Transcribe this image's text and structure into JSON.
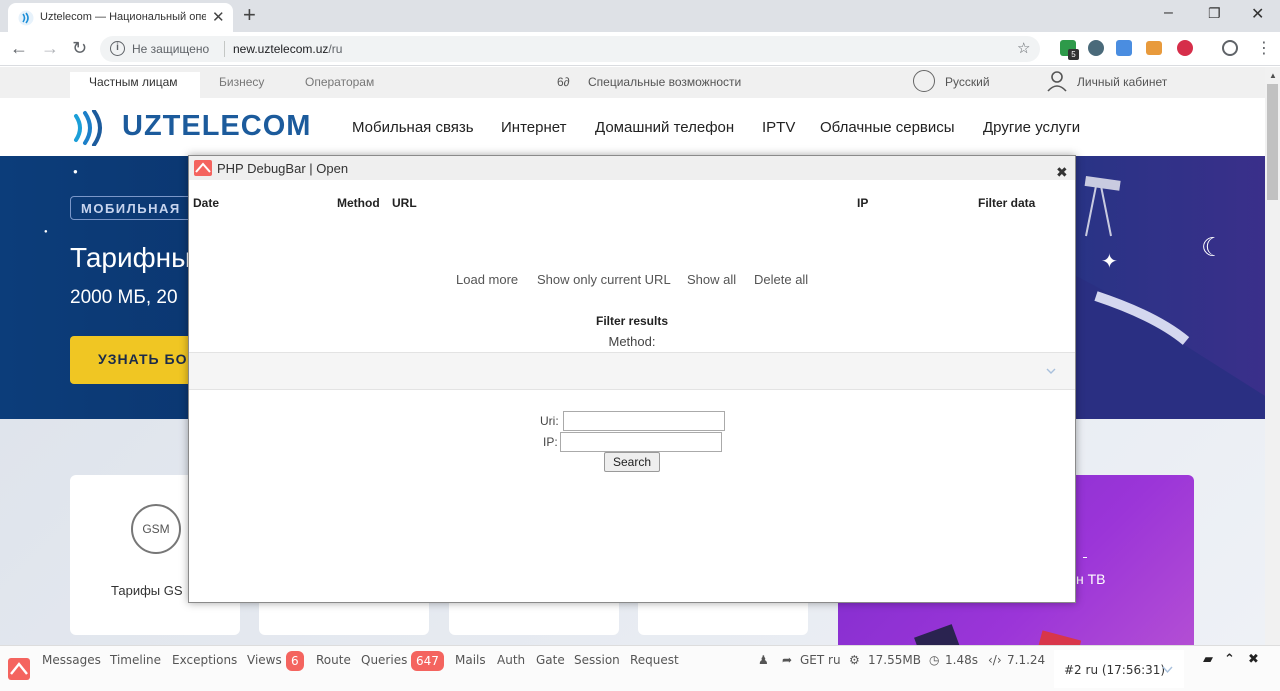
{
  "browser": {
    "tab_title": "Uztelecom — Национальный оператор",
    "tab_close": "✕",
    "new_tab": "+",
    "win_minimize": "–",
    "win_restore": "❐",
    "win_close": "✕",
    "back": "←",
    "forward": "→",
    "reload": "↻",
    "insecure_label": "Не защищено",
    "url_host": "new.uztelecom.uz",
    "url_path": "/ru",
    "star": "☆",
    "menu": "⋮",
    "ext_badge": "5"
  },
  "page": {
    "topnav": {
      "private": "Частным лицам",
      "business": "Бизнесу",
      "operators": "Операторам",
      "accessibility_icon": "6∂",
      "accessibility": "Специальные возможности",
      "language": "Русский",
      "cabinet": "Личный кабинет"
    },
    "logo_text": "UZTELECOM",
    "mainnav": [
      "Мобильная связь",
      "Интернет",
      "Домашний телефон",
      "IPTV",
      "Облачные сервисы",
      "Другие услуги"
    ],
    "hero": {
      "badge": "МОБИЛЬНАЯ",
      "title": "Тарифны",
      "subtitle": "2000 МБ, 20",
      "button": "УЗНАТЬ БО"
    },
    "cards": {
      "gsm_icon": "GSM",
      "gsm_title": "Тарифы GS",
      "promo_title": "н ТВ"
    }
  },
  "dialog": {
    "title": "PHP DebugBar | Open",
    "close": "✖",
    "columns": {
      "date": "Date",
      "method": "Method",
      "url": "URL",
      "ip": "IP",
      "filter": "Filter data"
    },
    "actions": {
      "load_more": "Load more",
      "current_url": "Show only current URL",
      "show_all": "Show all",
      "delete_all": "Delete all"
    },
    "filter_title": "Filter results",
    "method_label": "Method:",
    "uri_label": "Uri:",
    "ip_label": "IP:",
    "uri_value": "",
    "ip_value": "",
    "search_button": "Search"
  },
  "debugbar": {
    "tabs": {
      "messages": "Messages",
      "timeline": "Timeline",
      "exceptions": "Exceptions",
      "views": "Views",
      "views_count": "6",
      "route": "Route",
      "queries": "Queries",
      "queries_count": "647",
      "mails": "Mails",
      "auth": "Auth",
      "gate": "Gate",
      "session": "Session",
      "request": "Request"
    },
    "indicators": {
      "user_icon": "♟",
      "request_method": "GET ru",
      "memory": "17.55MB",
      "time": "1.48s",
      "php_version": "7.1.24"
    },
    "current_request": "#2 ru (17:56:31)",
    "controls": {
      "open": "▰",
      "maximize": "⌃",
      "close": "✖"
    }
  },
  "colors": {
    "brand_blue": "#1c5b9c",
    "hero_button": "#f0c623",
    "badge_red": "#f4645f",
    "promo_purple": "#8a2fd0"
  }
}
